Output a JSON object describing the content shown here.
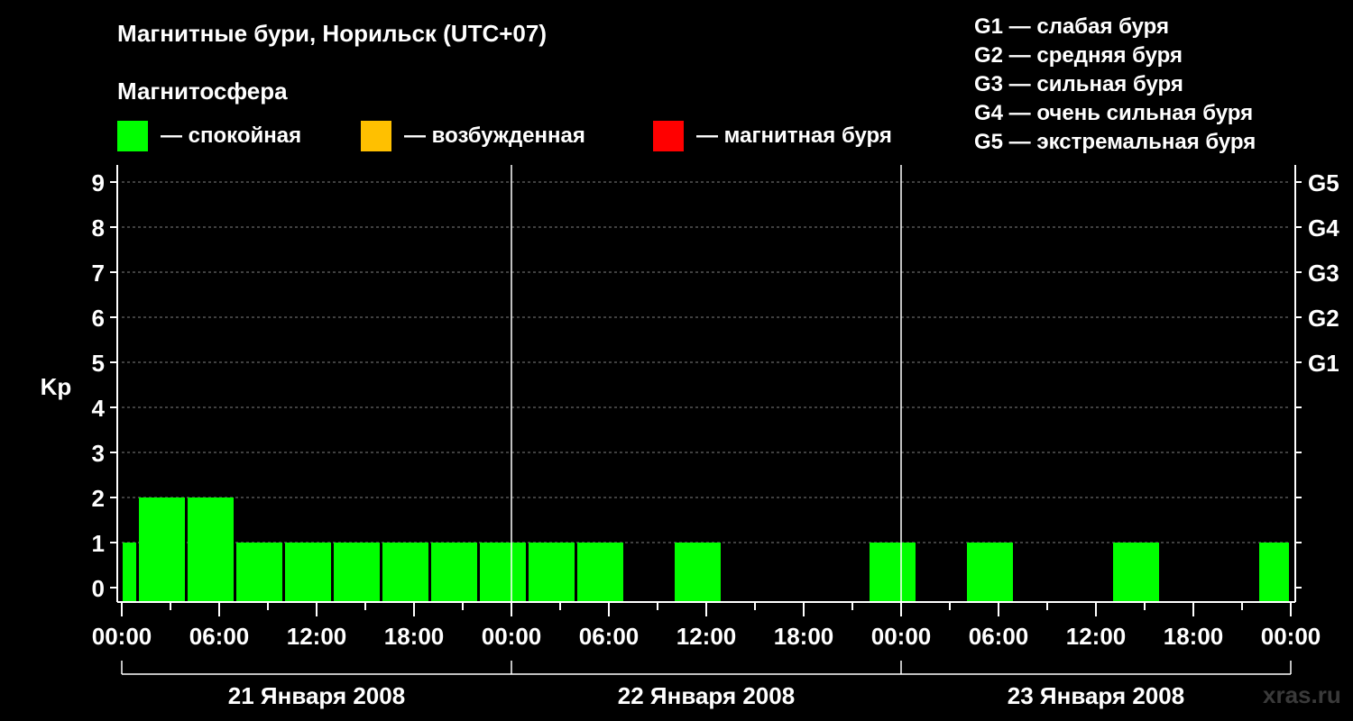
{
  "header": {
    "title": "Магнитные бури, Норильск (UTC+07)",
    "subtitle": "Магнитосфера"
  },
  "legend": [
    {
      "color": "#00ff00",
      "label": "— спокойная"
    },
    {
      "color": "#ffc000",
      "label": "— возбужденная"
    },
    {
      "color": "#ff0000",
      "label": "— магнитная буря"
    }
  ],
  "storm_levels": [
    "G1 — слабая буря",
    "G2 — средняя буря",
    "G3 — сильная буря",
    "G4 — очень сильная буря",
    "G5 — экстремальная буря"
  ],
  "watermark": "xras.ru",
  "chart_data": {
    "type": "bar",
    "ylabel": "Kp",
    "ylim": [
      0,
      9
    ],
    "yticks": [
      0,
      1,
      2,
      3,
      4,
      5,
      6,
      7,
      8,
      9
    ],
    "right_axis": [
      {
        "value": 5,
        "label": "G1"
      },
      {
        "value": 6,
        "label": "G2"
      },
      {
        "value": 7,
        "label": "G3"
      },
      {
        "value": 8,
        "label": "G4"
      },
      {
        "value": 9,
        "label": "G5"
      }
    ],
    "grid": "dashed horizontal",
    "xlim_hours": [
      0,
      72
    ],
    "xtick_labels": [
      "00:00",
      "06:00",
      "12:00",
      "18:00",
      "00:00",
      "06:00",
      "12:00",
      "18:00",
      "00:00",
      "06:00",
      "12:00",
      "18:00",
      "00:00"
    ],
    "days": [
      "21 Января 2008",
      "22 Января 2008",
      "23 Января 2008"
    ],
    "bar_color": "#00ff00",
    "bars": [
      {
        "start_hour": 0,
        "end_hour": 1,
        "kp": 1
      },
      {
        "start_hour": 1,
        "end_hour": 4,
        "kp": 2
      },
      {
        "start_hour": 4,
        "end_hour": 7,
        "kp": 2
      },
      {
        "start_hour": 7,
        "end_hour": 10,
        "kp": 1
      },
      {
        "start_hour": 10,
        "end_hour": 13,
        "kp": 1
      },
      {
        "start_hour": 13,
        "end_hour": 16,
        "kp": 1
      },
      {
        "start_hour": 16,
        "end_hour": 19,
        "kp": 1
      },
      {
        "start_hour": 19,
        "end_hour": 22,
        "kp": 1
      },
      {
        "start_hour": 22,
        "end_hour": 25,
        "kp": 1
      },
      {
        "start_hour": 25,
        "end_hour": 28,
        "kp": 1
      },
      {
        "start_hour": 28,
        "end_hour": 31,
        "kp": 1
      },
      {
        "start_hour": 31,
        "end_hour": 34,
        "kp": 0
      },
      {
        "start_hour": 34,
        "end_hour": 37,
        "kp": 1
      },
      {
        "start_hour": 37,
        "end_hour": 40,
        "kp": 0
      },
      {
        "start_hour": 40,
        "end_hour": 43,
        "kp": 0
      },
      {
        "start_hour": 43,
        "end_hour": 46,
        "kp": 0
      },
      {
        "start_hour": 46,
        "end_hour": 49,
        "kp": 1
      },
      {
        "start_hour": 49,
        "end_hour": 52,
        "kp": 0
      },
      {
        "start_hour": 52,
        "end_hour": 55,
        "kp": 1
      },
      {
        "start_hour": 55,
        "end_hour": 58,
        "kp": 0
      },
      {
        "start_hour": 58,
        "end_hour": 61,
        "kp": 0
      },
      {
        "start_hour": 61,
        "end_hour": 64,
        "kp": 1
      },
      {
        "start_hour": 64,
        "end_hour": 67,
        "kp": 0
      },
      {
        "start_hour": 67,
        "end_hour": 70,
        "kp": 0
      },
      {
        "start_hour": 70,
        "end_hour": 72,
        "kp": 1
      }
    ]
  }
}
